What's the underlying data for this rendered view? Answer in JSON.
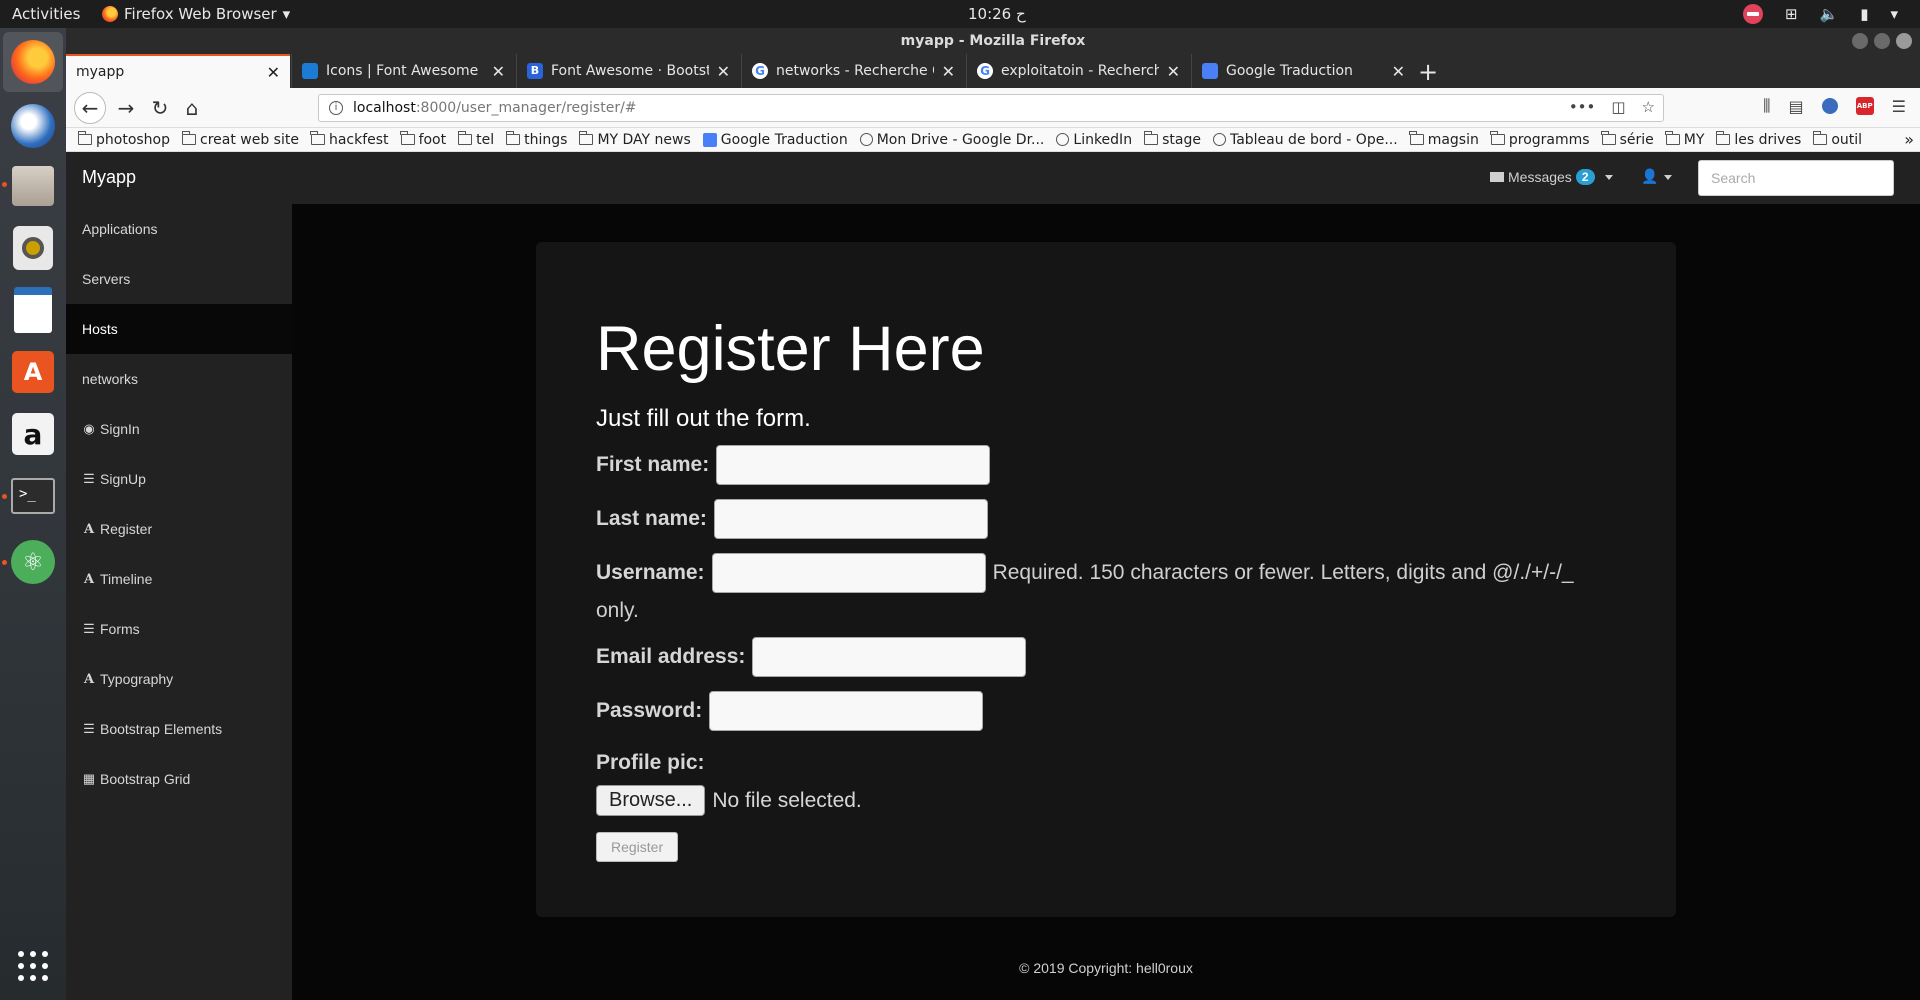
{
  "topbar": {
    "activities": "Activities",
    "app_name": "Firefox Web Browser",
    "clock": "10:26 ح"
  },
  "window": {
    "title": "myapp - Mozilla Firefox"
  },
  "tabs": [
    {
      "title": "myapp",
      "favicon": "none"
    },
    {
      "title": "Icons | Font Awesome",
      "favicon": "#1c7cd5"
    },
    {
      "title": "Font Awesome · Bootstr",
      "favicon": "#2b63d8"
    },
    {
      "title": "networks - Recherche Go",
      "favicon": "#ffffff"
    },
    {
      "title": "exploitatoin - Recherche",
      "favicon": "#ffffff"
    },
    {
      "title": "Google Traduction",
      "favicon": "#4a80f5"
    }
  ],
  "url": {
    "host": "localhost",
    "path": ":8000/user_manager/register/#"
  },
  "bookmarks": [
    {
      "label": "photoshop",
      "icon": "folder-icon"
    },
    {
      "label": "creat web site",
      "icon": "folder-icon"
    },
    {
      "label": "hackfest",
      "icon": "folder-icon"
    },
    {
      "label": "foot",
      "icon": "folder-icon"
    },
    {
      "label": "tel",
      "icon": "folder-icon"
    },
    {
      "label": "things",
      "icon": "folder-icon"
    },
    {
      "label": "MY DAY news",
      "icon": "folder-icon"
    },
    {
      "label": "Google Traduction",
      "icon": "gt-icon"
    },
    {
      "label": "Mon Drive - Google Dr...",
      "icon": "globe-icon"
    },
    {
      "label": "LinkedIn",
      "icon": "globe-icon"
    },
    {
      "label": "stage",
      "icon": "folder-icon"
    },
    {
      "label": "Tableau de bord - Ope...",
      "icon": "globe-icon"
    },
    {
      "label": "magsin",
      "icon": "folder-icon"
    },
    {
      "label": "programms",
      "icon": "folder-icon"
    },
    {
      "label": "série",
      "icon": "folder-icon"
    },
    {
      "label": "MY",
      "icon": "folder-icon"
    },
    {
      "label": "les drives",
      "icon": "folder-icon"
    },
    {
      "label": "outil",
      "icon": "folder-icon"
    }
  ],
  "app": {
    "brand": "Myapp",
    "messages_label": "Messages",
    "messages_count": "2",
    "search_placeholder": "Search"
  },
  "sidebar": [
    {
      "label": "Applications",
      "icon": ""
    },
    {
      "label": "Servers",
      "icon": ""
    },
    {
      "label": "Hosts",
      "icon": "",
      "active": true
    },
    {
      "label": "networks",
      "icon": ""
    },
    {
      "label": "SignIn",
      "icon": "globe-icon"
    },
    {
      "label": "SignUp",
      "icon": "list-icon"
    },
    {
      "label": "Register",
      "icon": "font-icon"
    },
    {
      "label": "Timeline",
      "icon": "font-icon"
    },
    {
      "label": "Forms",
      "icon": "list-icon"
    },
    {
      "label": "Typography",
      "icon": "font-icon"
    },
    {
      "label": "Bootstrap Elements",
      "icon": "list-icon"
    },
    {
      "label": "Bootstrap Grid",
      "icon": "grid-icon"
    }
  ],
  "form": {
    "title": "Register Here",
    "subtitle": "Just fill out the form.",
    "first_name_label": "First name:",
    "last_name_label": "Last name:",
    "username_label": "Username:",
    "username_help": "Required. 150 characters or fewer. Letters, digits and @/./+/-/_",
    "username_help_cont": "only.",
    "email_label": "Email address:",
    "password_label": "Password:",
    "profile_pic_label": "Profile pic:",
    "browse_label": "Browse...",
    "no_file_label": "No file selected.",
    "register_label": "Register"
  },
  "footer": {
    "text": "© 2019 Copyright: hell0roux"
  }
}
